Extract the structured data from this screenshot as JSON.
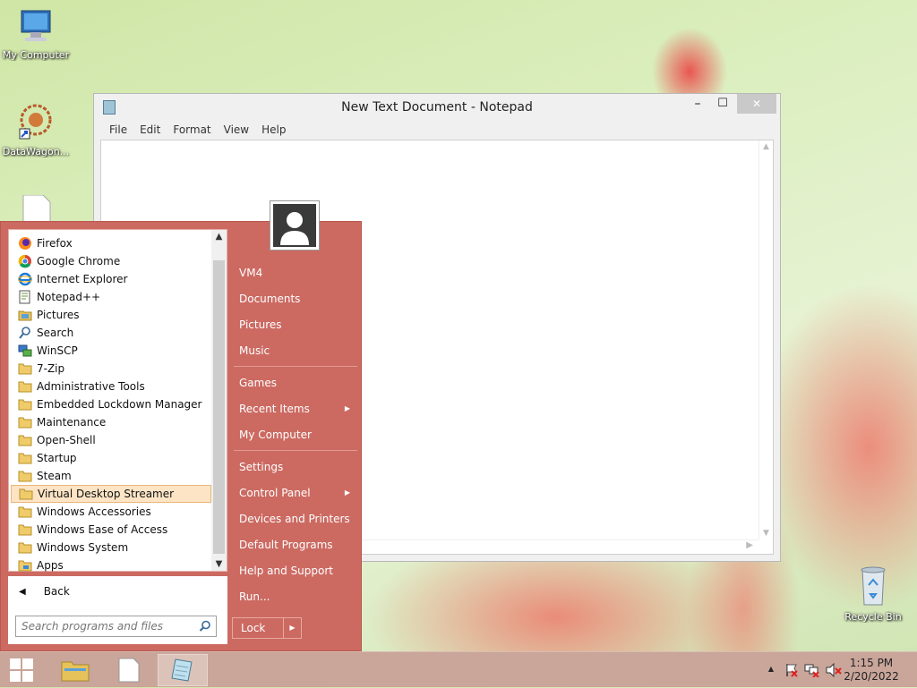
{
  "desktop": {
    "icons": [
      {
        "label": "My Computer"
      },
      {
        "label": "DataWagon..."
      },
      {
        "label": "Recycle Bin"
      }
    ]
  },
  "notepad": {
    "title": "New Text Document - Notepad",
    "controls": {
      "minimize": "–",
      "maximize": "☐",
      "close": "✕"
    },
    "menu": [
      "File",
      "Edit",
      "Format",
      "View",
      "Help"
    ],
    "content": ""
  },
  "start_menu": {
    "programs": [
      {
        "label": "Firefox",
        "icon": "firefox-icon"
      },
      {
        "label": "Google Chrome",
        "icon": "chrome-icon"
      },
      {
        "label": "Internet Explorer",
        "icon": "ie-icon"
      },
      {
        "label": "Notepad++",
        "icon": "notepadpp-icon"
      },
      {
        "label": "Pictures",
        "icon": "pictures-icon"
      },
      {
        "label": "Search",
        "icon": "search-icon"
      },
      {
        "label": "WinSCP",
        "icon": "winscp-icon"
      },
      {
        "label": "7-Zip",
        "icon": "folder-icon"
      },
      {
        "label": "Administrative Tools",
        "icon": "folder-icon"
      },
      {
        "label": "Embedded Lockdown Manager",
        "icon": "folder-icon"
      },
      {
        "label": "Maintenance",
        "icon": "folder-icon"
      },
      {
        "label": "Open-Shell",
        "icon": "folder-icon"
      },
      {
        "label": "Startup",
        "icon": "folder-icon"
      },
      {
        "label": "Steam",
        "icon": "folder-icon"
      },
      {
        "label": "Virtual Desktop Streamer",
        "icon": "folder-icon"
      },
      {
        "label": "Windows Accessories",
        "icon": "folder-icon"
      },
      {
        "label": "Windows Ease of Access",
        "icon": "folder-icon"
      },
      {
        "label": "Windows System",
        "icon": "folder-icon"
      },
      {
        "label": "Apps",
        "icon": "apps-folder-icon"
      }
    ],
    "highlighted": "Virtual Desktop Streamer",
    "back_label": "Back",
    "search_placeholder": "Search programs and files",
    "right_items": [
      {
        "label": "VM4"
      },
      {
        "label": "Documents"
      },
      {
        "label": "Pictures"
      },
      {
        "label": "Music"
      },
      {
        "label": "Games"
      },
      {
        "label": "Recent Items",
        "submenu": true
      },
      {
        "label": "My Computer"
      },
      {
        "label": "Settings"
      },
      {
        "label": "Control Panel",
        "submenu": true
      },
      {
        "label": "Devices and Printers"
      },
      {
        "label": "Default Programs"
      },
      {
        "label": "Help and Support"
      },
      {
        "label": "Run..."
      }
    ],
    "lock_label": "Lock",
    "accent_color": "#cc6a62"
  },
  "taskbar": {
    "clock_time": "1:15 PM",
    "clock_date": "2/20/2022",
    "tray_overflow": "▲"
  }
}
